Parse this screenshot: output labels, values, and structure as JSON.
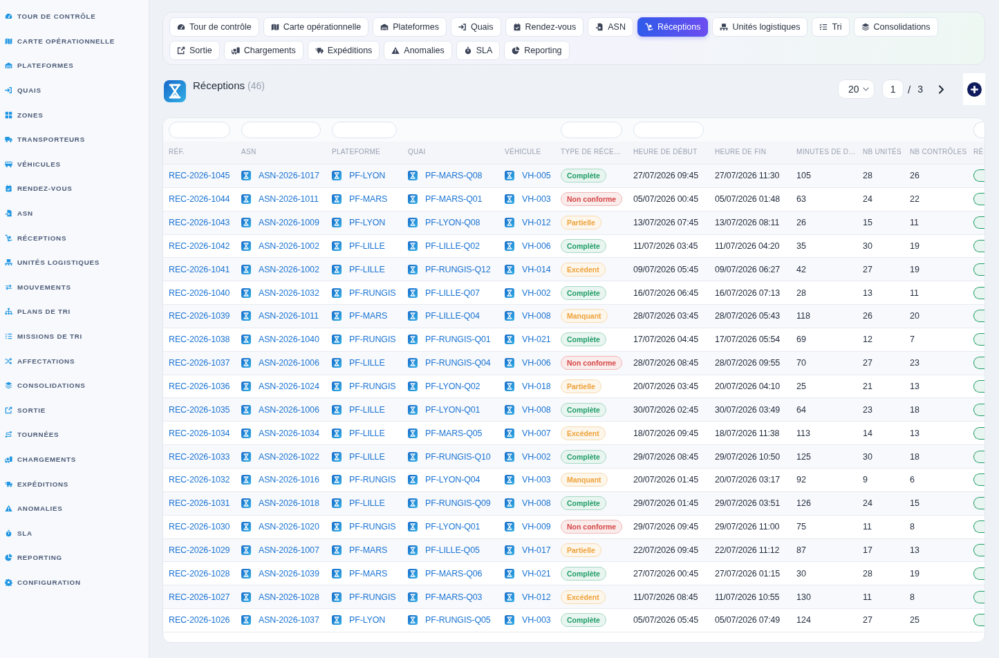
{
  "sidebar": {
    "items": [
      "TOUR DE CONTRÔLE",
      "CARTE OPÉRATIONNELLE",
      "PLATEFORMES",
      "QUAIS",
      "ZONES",
      "TRANSPORTEURS",
      "VÉHICULES",
      "RENDEZ-VOUS",
      "ASN",
      "RÉCEPTIONS",
      "UNITÉS LOGISTIQUES",
      "MOUVEMENTS",
      "PLANS DE TRI",
      "MISSIONS DE TRI",
      "AFFECTATIONS",
      "CONSOLIDATIONS",
      "SORTIE",
      "TOURNÉES",
      "CHARGEMENTS",
      "EXPÉDITIONS",
      "ANOMALIES",
      "SLA",
      "REPORTING",
      "CONFIGURATION"
    ]
  },
  "tab_rows": [
    [
      {
        "label": "Tour de contrôle",
        "selected": false
      },
      {
        "label": "Carte opérationnelle",
        "selected": false
      },
      {
        "label": "Plateformes",
        "selected": false
      },
      {
        "label": "Quais",
        "selected": false
      },
      {
        "label": "Rendez-vous",
        "selected": false
      },
      {
        "label": "ASN",
        "selected": false
      },
      {
        "label": "Réceptions",
        "selected": true
      },
      {
        "label": "Unités logistiques",
        "selected": false
      },
      {
        "label": "Tri",
        "selected": false
      },
      {
        "label": "Consolidations",
        "selected": false
      }
    ],
    [
      {
        "label": "Sortie",
        "selected": false
      },
      {
        "label": "Chargements",
        "selected": false
      },
      {
        "label": "Expéditions",
        "selected": false
      },
      {
        "label": "Anomalies",
        "selected": false
      },
      {
        "label": "SLA",
        "selected": false
      },
      {
        "label": "Reporting",
        "selected": false
      }
    ]
  ],
  "header": {
    "title": "Réceptions",
    "count": "(46)",
    "page_size": "20",
    "page": "1",
    "page_separator": "/",
    "page_total": "3"
  },
  "table": {
    "columns": [
      {
        "label": "RÉF.",
        "filter": true
      },
      {
        "label": "ASN",
        "filter": true
      },
      {
        "label": "PLATEFORME",
        "filter": true
      },
      {
        "label": "QUAI",
        "filter": false
      },
      {
        "label": "VÉHICULE",
        "filter": false
      },
      {
        "label": "TYPE DE RÉCE…",
        "filter": true
      },
      {
        "label": "HEURE DE DÉBUT",
        "filter": true
      },
      {
        "label": "HEURE DE FIN",
        "filter": false
      },
      {
        "label": "MINUTES DE D…",
        "filter": false
      },
      {
        "label": "NB UNITÉS",
        "filter": false
      },
      {
        "label": "NB CONTRÔLES",
        "filter": false
      },
      {
        "label": "RÉ",
        "filter": true
      }
    ],
    "rows": [
      {
        "ref": "REC-2026-1045",
        "asn": "ASN-2026-1017",
        "platform": "PF-LYON",
        "dock": "PF-MARS-Q08",
        "vehicle": "VH-005",
        "type": {
          "label": "Complète",
          "color": "#1f9d67"
        },
        "start": "27/07/2026 09:45",
        "end": "27/07/2026 11:30",
        "minutes": "105",
        "units": "28",
        "checks": "26",
        "column_12": {
          "color": "#1f9d67"
        }
      },
      {
        "ref": "REC-2026-1044",
        "asn": "ASN-2026-1011",
        "platform": "PF-MARS",
        "dock": "PF-MARS-Q01",
        "vehicle": "VH-003",
        "type": {
          "label": "Non conforme",
          "color": "#d64545"
        },
        "start": "05/07/2026 00:45",
        "end": "05/07/2026 01:48",
        "minutes": "63",
        "units": "24",
        "checks": "22",
        "column_12": {
          "color": "#1f9d67"
        }
      },
      {
        "ref": "REC-2026-1043",
        "asn": "ASN-2026-1009",
        "platform": "PF-LYON",
        "dock": "PF-LYON-Q08",
        "vehicle": "VH-012",
        "type": {
          "label": "Partielle",
          "color": "#eea23a"
        },
        "start": "13/07/2026 07:45",
        "end": "13/07/2026 08:11",
        "minutes": "26",
        "units": "15",
        "checks": "11",
        "column_12": {
          "color": "#1f9d67"
        }
      },
      {
        "ref": "REC-2026-1042",
        "asn": "ASN-2026-1002",
        "platform": "PF-LILLE",
        "dock": "PF-LILLE-Q02",
        "vehicle": "VH-006",
        "type": {
          "label": "Complète",
          "color": "#1f9d67"
        },
        "start": "11/07/2026 03:45",
        "end": "11/07/2026 04:20",
        "minutes": "35",
        "units": "30",
        "checks": "19",
        "column_12": {
          "color": "#1f9d67"
        }
      },
      {
        "ref": "REC-2026-1041",
        "asn": "ASN-2026-1002",
        "platform": "PF-LILLE",
        "dock": "PF-RUNGIS-Q12",
        "vehicle": "VH-014",
        "type": {
          "label": "Excédent",
          "color": "#eea23a"
        },
        "start": "09/07/2026 05:45",
        "end": "09/07/2026 06:27",
        "minutes": "42",
        "units": "27",
        "checks": "19",
        "column_12": {
          "color": "#1f9d67"
        }
      },
      {
        "ref": "REC-2026-1040",
        "asn": "ASN-2026-1032",
        "platform": "PF-RUNGIS",
        "dock": "PF-LILLE-Q07",
        "vehicle": "VH-002",
        "type": {
          "label": "Complète",
          "color": "#1f9d67"
        },
        "start": "16/07/2026 06:45",
        "end": "16/07/2026 07:13",
        "minutes": "28",
        "units": "13",
        "checks": "11",
        "column_12": {
          "color": "#1f9d67"
        }
      },
      {
        "ref": "REC-2026-1039",
        "asn": "ASN-2026-1011",
        "platform": "PF-MARS",
        "dock": "PF-LILLE-Q04",
        "vehicle": "VH-008",
        "type": {
          "label": "Manquant",
          "color": "#eea23a"
        },
        "start": "28/07/2026 03:45",
        "end": "28/07/2026 05:43",
        "minutes": "118",
        "units": "26",
        "checks": "20",
        "column_12": {
          "color": "#1f9d67"
        }
      },
      {
        "ref": "REC-2026-1038",
        "asn": "ASN-2026-1040",
        "platform": "PF-RUNGIS",
        "dock": "PF-RUNGIS-Q01",
        "vehicle": "VH-021",
        "type": {
          "label": "Complète",
          "color": "#1f9d67"
        },
        "start": "17/07/2026 04:45",
        "end": "17/07/2026 05:54",
        "minutes": "69",
        "units": "12",
        "checks": "7",
        "column_12": {
          "color": "#1f9d67"
        }
      },
      {
        "ref": "REC-2026-1037",
        "asn": "ASN-2026-1006",
        "platform": "PF-LILLE",
        "dock": "PF-RUNGIS-Q04",
        "vehicle": "VH-006",
        "type": {
          "label": "Non conforme",
          "color": "#d64545"
        },
        "start": "28/07/2026 08:45",
        "end": "28/07/2026 09:55",
        "minutes": "70",
        "units": "27",
        "checks": "23",
        "column_12": {
          "color": "#1f9d67"
        }
      },
      {
        "ref": "REC-2026-1036",
        "asn": "ASN-2026-1024",
        "platform": "PF-RUNGIS",
        "dock": "PF-LYON-Q02",
        "vehicle": "VH-018",
        "type": {
          "label": "Partielle",
          "color": "#eea23a"
        },
        "start": "20/07/2026 03:45",
        "end": "20/07/2026 04:10",
        "minutes": "25",
        "units": "21",
        "checks": "13",
        "column_12": {
          "color": "#1f9d67"
        }
      },
      {
        "ref": "REC-2026-1035",
        "asn": "ASN-2026-1006",
        "platform": "PF-LILLE",
        "dock": "PF-LYON-Q01",
        "vehicle": "VH-008",
        "type": {
          "label": "Complète",
          "color": "#1f9d67"
        },
        "start": "30/07/2026 02:45",
        "end": "30/07/2026 03:49",
        "minutes": "64",
        "units": "23",
        "checks": "18",
        "column_12": {
          "color": "#1f9d67"
        }
      },
      {
        "ref": "REC-2026-1034",
        "asn": "ASN-2026-1034",
        "platform": "PF-LILLE",
        "dock": "PF-MARS-Q05",
        "vehicle": "VH-007",
        "type": {
          "label": "Excédent",
          "color": "#eea23a"
        },
        "start": "18/07/2026 09:45",
        "end": "18/07/2026 11:38",
        "minutes": "113",
        "units": "14",
        "checks": "13",
        "column_12": {
          "color": "#1f9d67"
        }
      },
      {
        "ref": "REC-2026-1033",
        "asn": "ASN-2026-1022",
        "platform": "PF-LILLE",
        "dock": "PF-RUNGIS-Q10",
        "vehicle": "VH-002",
        "type": {
          "label": "Complète",
          "color": "#1f9d67"
        },
        "start": "29/07/2026 08:45",
        "end": "29/07/2026 10:50",
        "minutes": "125",
        "units": "30",
        "checks": "18",
        "column_12": {
          "color": "#1f9d67"
        }
      },
      {
        "ref": "REC-2026-1032",
        "asn": "ASN-2026-1016",
        "platform": "PF-RUNGIS",
        "dock": "PF-LYON-Q04",
        "vehicle": "VH-003",
        "type": {
          "label": "Manquant",
          "color": "#eea23a"
        },
        "start": "20/07/2026 01:45",
        "end": "20/07/2026 03:17",
        "minutes": "92",
        "units": "9",
        "checks": "6",
        "column_12": {
          "color": "#1f9d67"
        }
      },
      {
        "ref": "REC-2026-1031",
        "asn": "ASN-2026-1018",
        "platform": "PF-LILLE",
        "dock": "PF-RUNGIS-Q09",
        "vehicle": "VH-008",
        "type": {
          "label": "Complète",
          "color": "#1f9d67"
        },
        "start": "29/07/2026 01:45",
        "end": "29/07/2026 03:51",
        "minutes": "126",
        "units": "24",
        "checks": "15",
        "column_12": {
          "color": "#1f9d67"
        }
      },
      {
        "ref": "REC-2026-1030",
        "asn": "ASN-2026-1020",
        "platform": "PF-RUNGIS",
        "dock": "PF-LYON-Q01",
        "vehicle": "VH-009",
        "type": {
          "label": "Non conforme",
          "color": "#d64545"
        },
        "start": "29/07/2026 09:45",
        "end": "29/07/2026 11:00",
        "minutes": "75",
        "units": "11",
        "checks": "8",
        "column_12": {
          "color": "#1f9d67"
        }
      },
      {
        "ref": "REC-2026-1029",
        "asn": "ASN-2026-1007",
        "platform": "PF-MARS",
        "dock": "PF-LILLE-Q05",
        "vehicle": "VH-017",
        "type": {
          "label": "Partielle",
          "color": "#eea23a"
        },
        "start": "22/07/2026 09:45",
        "end": "22/07/2026 11:12",
        "minutes": "87",
        "units": "17",
        "checks": "13",
        "column_12": {
          "color": "#1f9d67"
        }
      },
      {
        "ref": "REC-2026-1028",
        "asn": "ASN-2026-1039",
        "platform": "PF-MARS",
        "dock": "PF-MARS-Q06",
        "vehicle": "VH-021",
        "type": {
          "label": "Complète",
          "color": "#1f9d67"
        },
        "start": "27/07/2026 00:45",
        "end": "27/07/2026 01:15",
        "minutes": "30",
        "units": "28",
        "checks": "19",
        "column_12": {
          "color": "#1f9d67"
        }
      },
      {
        "ref": "REC-2026-1027",
        "asn": "ASN-2026-1028",
        "platform": "PF-RUNGIS",
        "dock": "PF-MARS-Q03",
        "vehicle": "VH-012",
        "type": {
          "label": "Excédent",
          "color": "#eea23a"
        },
        "start": "11/07/2026 08:45",
        "end": "11/07/2026 10:55",
        "minutes": "130",
        "units": "11",
        "checks": "8",
        "column_12": {
          "color": "#1f9d67"
        }
      },
      {
        "ref": "REC-2026-1026",
        "asn": "ASN-2026-1037",
        "platform": "PF-LYON",
        "dock": "PF-RUNGIS-Q05",
        "vehicle": "VH-003",
        "type": {
          "label": "Complète",
          "color": "#1f9d67"
        },
        "start": "05/07/2026 05:45",
        "end": "05/07/2026 07:49",
        "minutes": "124",
        "units": "27",
        "checks": "25",
        "column_12": {
          "color": "#1f9d67"
        }
      }
    ]
  }
}
